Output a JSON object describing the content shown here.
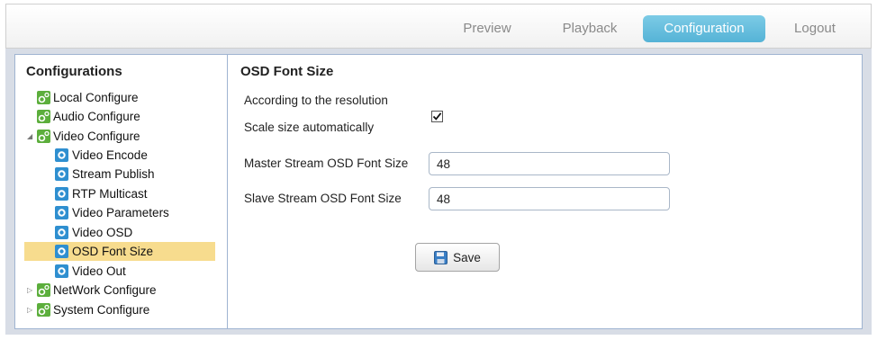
{
  "nav": {
    "preview": "Preview",
    "playback": "Playback",
    "configuration": "Configuration",
    "logout": "Logout",
    "active": "Configuration",
    "active_color": "#5bb8d9"
  },
  "sidebar": {
    "title": "Configurations",
    "items": [
      {
        "label": "Local Configure",
        "icon": "gear-green-icon"
      },
      {
        "label": "Audio Configure",
        "icon": "gear-green-icon"
      },
      {
        "label": "Video Configure",
        "icon": "gear-green-icon",
        "expanded": true,
        "children": [
          {
            "label": "Video Encode",
            "icon": "gear-blue-icon"
          },
          {
            "label": "Stream Publish",
            "icon": "gear-blue-icon"
          },
          {
            "label": "RTP Multicast",
            "icon": "gear-blue-icon"
          },
          {
            "label": "Video Parameters",
            "icon": "gear-blue-icon"
          },
          {
            "label": "Video OSD",
            "icon": "gear-blue-icon"
          },
          {
            "label": "OSD Font Size",
            "icon": "gear-blue-icon",
            "selected": true
          },
          {
            "label": "Video Out",
            "icon": "gear-blue-icon"
          }
        ]
      },
      {
        "label": "NetWork Configure",
        "icon": "gear-green-icon",
        "expanded": false
      },
      {
        "label": "System Configure",
        "icon": "gear-green-icon",
        "expanded": false
      }
    ],
    "selected_color": "#f7dc8e"
  },
  "content": {
    "title": "OSD Font Size",
    "auto_line1": "According to the resolution",
    "auto_line2": "Scale size automatically",
    "auto_checked": true,
    "master_label": "Master Stream OSD Font Size",
    "master_value": "48",
    "slave_label": "Slave Stream OSD Font Size",
    "slave_value": "48",
    "save_label": "Save"
  }
}
